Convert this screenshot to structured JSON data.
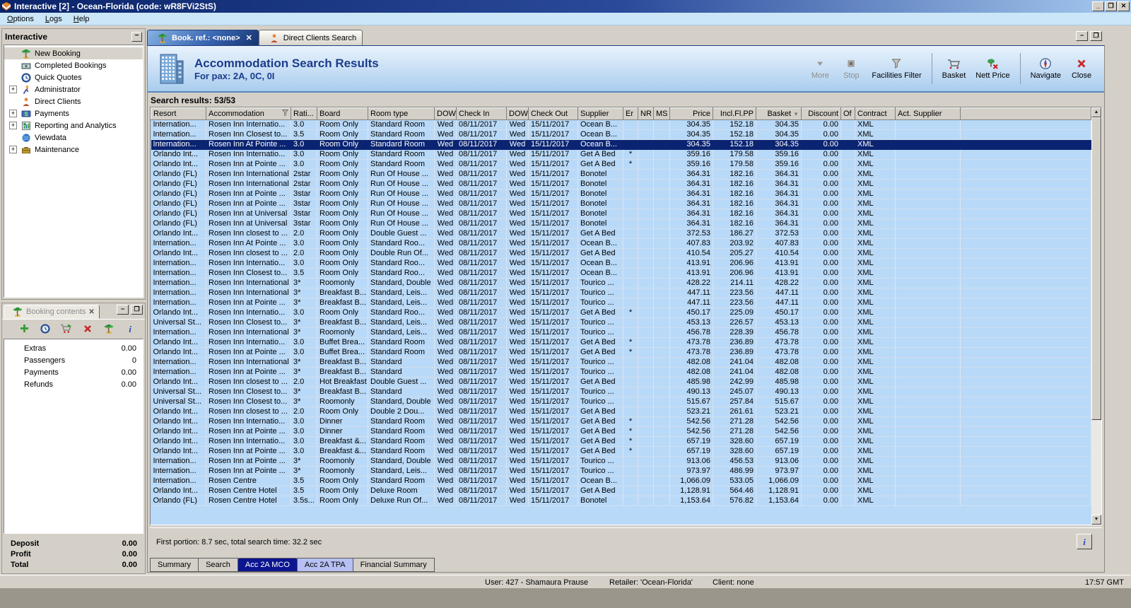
{
  "window": {
    "title": "Interactive [2] - Ocean-Florida (code: wR8FVi2StS)"
  },
  "menu": {
    "items": [
      "Options",
      "Logs",
      "Help"
    ]
  },
  "sidebar": {
    "title": "Interactive",
    "items": [
      {
        "label": "New Booking",
        "icon": "palm",
        "expandable": false,
        "selected": true
      },
      {
        "label": "Completed Bookings",
        "icon": "money",
        "expandable": false
      },
      {
        "label": "Quick Quotes",
        "icon": "clock",
        "expandable": false
      },
      {
        "label": "Administrator",
        "icon": "admin",
        "expandable": true
      },
      {
        "label": "Direct Clients",
        "icon": "person",
        "expandable": false
      },
      {
        "label": "Payments",
        "icon": "dollar",
        "expandable": true
      },
      {
        "label": "Reporting and Analytics",
        "icon": "chart",
        "expandable": true
      },
      {
        "label": "Viewdata",
        "icon": "globe",
        "expandable": false
      },
      {
        "label": "Maintenance",
        "icon": "toolbox",
        "expandable": true
      }
    ]
  },
  "booking_contents": {
    "title": "Booking contents",
    "toolbar": [
      {
        "name": "add-icon",
        "icon": "add"
      },
      {
        "name": "quick-quote-icon",
        "icon": "clock"
      },
      {
        "name": "move-to-basket-icon",
        "icon": "cartarrow"
      },
      {
        "name": "delete-icon",
        "icon": "del"
      },
      {
        "name": "new-booking-icon",
        "icon": "palm"
      },
      {
        "name": "info-icon",
        "icon": "info"
      }
    ],
    "rows": [
      [
        "Extras",
        "0.00"
      ],
      [
        "Passengers",
        "0"
      ],
      [
        "Payments",
        "0.00"
      ],
      [
        "Refunds",
        "0.00"
      ]
    ],
    "totals": [
      [
        "Deposit",
        "0.00"
      ],
      [
        "Profit",
        "0.00"
      ],
      [
        "Total",
        "0.00"
      ]
    ]
  },
  "tabs": [
    {
      "label": "Book. ref.: <none>",
      "icon": "palm",
      "active": true,
      "closable": true
    },
    {
      "label": "Direct Clients Search",
      "icon": "person",
      "active": false,
      "closable": false
    }
  ],
  "header": {
    "title": "Accommodation Search Results",
    "subtitle": "For pax: 2A, 0C, 0I"
  },
  "toolbar": [
    {
      "label": "More",
      "icon": "more",
      "disabled": true
    },
    {
      "label": "Stop",
      "icon": "stop",
      "disabled": true
    },
    {
      "label": "Facilities Filter",
      "icon": "funnel",
      "disabled": false
    },
    {
      "sep": true
    },
    {
      "label": "Basket",
      "icon": "basket",
      "disabled": false
    },
    {
      "label": "Nett Price",
      "icon": "nett",
      "disabled": false
    },
    {
      "sep": true
    },
    {
      "label": "Navigate",
      "icon": "compass",
      "disabled": false
    },
    {
      "label": "Close",
      "icon": "closex",
      "disabled": false
    }
  ],
  "results": {
    "label": "Search results: 53/53"
  },
  "table": {
    "columns": [
      "Resort",
      "Accommodation",
      "Rati...",
      "Board",
      "Room type",
      "DOW",
      "Check In",
      "DOW",
      "Check Out",
      "Supplier",
      "Er",
      "NR",
      "MS",
      "Price",
      "Incl.Fl.PP",
      "Basket",
      "Discount",
      "Of",
      "Contract",
      "Act. Supplier"
    ],
    "selected_index": 2,
    "rows": [
      [
        "Internation...",
        "Rosen Inn Internatio...",
        "3.0",
        "Room Only",
        "Standard Room",
        "Wed",
        "08/11/2017",
        "Wed",
        "15/11/2017",
        "Ocean B...",
        "",
        "",
        "",
        "304.35",
        "152.18",
        "304.35",
        "0.00",
        "",
        "XML",
        ""
      ],
      [
        "Internation...",
        "Rosen Inn Closest to...",
        "3.5",
        "Room Only",
        "Standard Room",
        "Wed",
        "08/11/2017",
        "Wed",
        "15/11/2017",
        "Ocean B...",
        "",
        "",
        "",
        "304.35",
        "152.18",
        "304.35",
        "0.00",
        "",
        "XML",
        ""
      ],
      [
        "Internation...",
        "Rosen Inn At Pointe ...",
        "3.0",
        "Room Only",
        "Standard Room",
        "Wed",
        "08/11/2017",
        "Wed",
        "15/11/2017",
        "Ocean B...",
        "",
        "",
        "",
        "304.35",
        "152.18",
        "304.35",
        "0.00",
        "",
        "XML",
        ""
      ],
      [
        "Orlando Int...",
        "Rosen Inn Internatio...",
        "3.0",
        "Room Only",
        "Standard Room",
        "Wed",
        "08/11/2017",
        "Wed",
        "15/11/2017",
        "Get A Bed",
        "*",
        "",
        "",
        "359.16",
        "179.58",
        "359.16",
        "0.00",
        "",
        "XML",
        ""
      ],
      [
        "Orlando Int...",
        "Rosen Inn at Pointe ...",
        "3.0",
        "Room Only",
        "Standard Room",
        "Wed",
        "08/11/2017",
        "Wed",
        "15/11/2017",
        "Get A Bed",
        "*",
        "",
        "",
        "359.16",
        "179.58",
        "359.16",
        "0.00",
        "",
        "XML",
        ""
      ],
      [
        "Orlando (FL)",
        "Rosen Inn International",
        "2star",
        "Room Only",
        "Run Of House ...",
        "Wed",
        "08/11/2017",
        "Wed",
        "15/11/2017",
        "Bonotel",
        "",
        "",
        "",
        "364.31",
        "182.16",
        "364.31",
        "0.00",
        "",
        "XML",
        ""
      ],
      [
        "Orlando (FL)",
        "Rosen Inn International",
        "2star",
        "Room Only",
        "Run Of House ...",
        "Wed",
        "08/11/2017",
        "Wed",
        "15/11/2017",
        "Bonotel",
        "",
        "",
        "",
        "364.31",
        "182.16",
        "364.31",
        "0.00",
        "",
        "XML",
        ""
      ],
      [
        "Orlando (FL)",
        "Rosen Inn at Pointe ...",
        "3star",
        "Room Only",
        "Run Of House ...",
        "Wed",
        "08/11/2017",
        "Wed",
        "15/11/2017",
        "Bonotel",
        "",
        "",
        "",
        "364.31",
        "182.16",
        "364.31",
        "0.00",
        "",
        "XML",
        ""
      ],
      [
        "Orlando (FL)",
        "Rosen Inn at Pointe ...",
        "3star",
        "Room Only",
        "Run Of House ...",
        "Wed",
        "08/11/2017",
        "Wed",
        "15/11/2017",
        "Bonotel",
        "",
        "",
        "",
        "364.31",
        "182.16",
        "364.31",
        "0.00",
        "",
        "XML",
        ""
      ],
      [
        "Orlando (FL)",
        "Rosen Inn at Universal",
        "3star",
        "Room Only",
        "Run Of House ...",
        "Wed",
        "08/11/2017",
        "Wed",
        "15/11/2017",
        "Bonotel",
        "",
        "",
        "",
        "364.31",
        "182.16",
        "364.31",
        "0.00",
        "",
        "XML",
        ""
      ],
      [
        "Orlando (FL)",
        "Rosen Inn at Universal",
        "3star",
        "Room Only",
        "Run Of House ...",
        "Wed",
        "08/11/2017",
        "Wed",
        "15/11/2017",
        "Bonotel",
        "",
        "",
        "",
        "364.31",
        "182.16",
        "364.31",
        "0.00",
        "",
        "XML",
        ""
      ],
      [
        "Orlando Int...",
        "Rosen Inn closest to ...",
        "2.0",
        "Room Only",
        "Double Guest ...",
        "Wed",
        "08/11/2017",
        "Wed",
        "15/11/2017",
        "Get A Bed",
        "",
        "",
        "",
        "372.53",
        "186.27",
        "372.53",
        "0.00",
        "",
        "XML",
        ""
      ],
      [
        "Internation...",
        "Rosen Inn At Pointe ...",
        "3.0",
        "Room Only",
        "Standard Roo...",
        "Wed",
        "08/11/2017",
        "Wed",
        "15/11/2017",
        "Ocean B...",
        "",
        "",
        "",
        "407.83",
        "203.92",
        "407.83",
        "0.00",
        "",
        "XML",
        ""
      ],
      [
        "Orlando Int...",
        "Rosen Inn closest to ...",
        "2.0",
        "Room Only",
        "Double Run Of...",
        "Wed",
        "08/11/2017",
        "Wed",
        "15/11/2017",
        "Get A Bed",
        "",
        "",
        "",
        "410.54",
        "205.27",
        "410.54",
        "0.00",
        "",
        "XML",
        ""
      ],
      [
        "Internation...",
        "Rosen Inn Internatio...",
        "3.0",
        "Room Only",
        "Standard Roo...",
        "Wed",
        "08/11/2017",
        "Wed",
        "15/11/2017",
        "Ocean B...",
        "",
        "",
        "",
        "413.91",
        "206.96",
        "413.91",
        "0.00",
        "",
        "XML",
        ""
      ],
      [
        "Internation...",
        "Rosen Inn Closest to...",
        "3.5",
        "Room Only",
        "Standard Roo...",
        "Wed",
        "08/11/2017",
        "Wed",
        "15/11/2017",
        "Ocean B...",
        "",
        "",
        "",
        "413.91",
        "206.96",
        "413.91",
        "0.00",
        "",
        "XML",
        ""
      ],
      [
        "Internation...",
        "Rosen Inn International",
        "3*",
        "Roomonly",
        "Standard, Double",
        "Wed",
        "08/11/2017",
        "Wed",
        "15/11/2017",
        "Tourico ...",
        "",
        "",
        "",
        "428.22",
        "214.11",
        "428.22",
        "0.00",
        "",
        "XML",
        ""
      ],
      [
        "Internation...",
        "Rosen Inn International",
        "3*",
        "Breakfast B...",
        "Standard, Leis...",
        "Wed",
        "08/11/2017",
        "Wed",
        "15/11/2017",
        "Tourico ...",
        "",
        "",
        "",
        "447.11",
        "223.56",
        "447.11",
        "0.00",
        "",
        "XML",
        ""
      ],
      [
        "Internation...",
        "Rosen Inn at Pointe ...",
        "3*",
        "Breakfast B...",
        "Standard, Leis...",
        "Wed",
        "08/11/2017",
        "Wed",
        "15/11/2017",
        "Tourico ...",
        "",
        "",
        "",
        "447.11",
        "223.56",
        "447.11",
        "0.00",
        "",
        "XML",
        ""
      ],
      [
        "Orlando Int...",
        "Rosen Inn Internatio...",
        "3.0",
        "Room Only",
        "Standard Roo...",
        "Wed",
        "08/11/2017",
        "Wed",
        "15/11/2017",
        "Get A Bed",
        "*",
        "",
        "",
        "450.17",
        "225.09",
        "450.17",
        "0.00",
        "",
        "XML",
        ""
      ],
      [
        "Universal St...",
        "Rosen Inn Closest to...",
        "3*",
        "Breakfast B...",
        "Standard, Leis...",
        "Wed",
        "08/11/2017",
        "Wed",
        "15/11/2017",
        "Tourico ...",
        "",
        "",
        "",
        "453.13",
        "226.57",
        "453.13",
        "0.00",
        "",
        "XML",
        ""
      ],
      [
        "Internation...",
        "Rosen Inn International",
        "3*",
        "Roomonly",
        "Standard, Leis...",
        "Wed",
        "08/11/2017",
        "Wed",
        "15/11/2017",
        "Tourico ...",
        "",
        "",
        "",
        "456.78",
        "228.39",
        "456.78",
        "0.00",
        "",
        "XML",
        ""
      ],
      [
        "Orlando Int...",
        "Rosen Inn Internatio...",
        "3.0",
        "Buffet Brea...",
        "Standard Room",
        "Wed",
        "08/11/2017",
        "Wed",
        "15/11/2017",
        "Get A Bed",
        "*",
        "",
        "",
        "473.78",
        "236.89",
        "473.78",
        "0.00",
        "",
        "XML",
        ""
      ],
      [
        "Orlando Int...",
        "Rosen Inn at Pointe ...",
        "3.0",
        "Buffet Brea...",
        "Standard Room",
        "Wed",
        "08/11/2017",
        "Wed",
        "15/11/2017",
        "Get A Bed",
        "*",
        "",
        "",
        "473.78",
        "236.89",
        "473.78",
        "0.00",
        "",
        "XML",
        ""
      ],
      [
        "Internation...",
        "Rosen Inn International",
        "3*",
        "Breakfast B...",
        "Standard",
        "Wed",
        "08/11/2017",
        "Wed",
        "15/11/2017",
        "Tourico ...",
        "",
        "",
        "",
        "482.08",
        "241.04",
        "482.08",
        "0.00",
        "",
        "XML",
        ""
      ],
      [
        "Internation...",
        "Rosen Inn at Pointe ...",
        "3*",
        "Breakfast B...",
        "Standard",
        "Wed",
        "08/11/2017",
        "Wed",
        "15/11/2017",
        "Tourico ...",
        "",
        "",
        "",
        "482.08",
        "241.04",
        "482.08",
        "0.00",
        "",
        "XML",
        ""
      ],
      [
        "Orlando Int...",
        "Rosen Inn closest to ...",
        "2.0",
        "Hot Breakfast",
        "Double Guest ...",
        "Wed",
        "08/11/2017",
        "Wed",
        "15/11/2017",
        "Get A Bed",
        "",
        "",
        "",
        "485.98",
        "242.99",
        "485.98",
        "0.00",
        "",
        "XML",
        ""
      ],
      [
        "Universal St...",
        "Rosen Inn Closest to...",
        "3*",
        "Breakfast B...",
        "Standard",
        "Wed",
        "08/11/2017",
        "Wed",
        "15/11/2017",
        "Tourico ...",
        "",
        "",
        "",
        "490.13",
        "245.07",
        "490.13",
        "0.00",
        "",
        "XML",
        ""
      ],
      [
        "Universal St...",
        "Rosen Inn Closest to...",
        "3*",
        "Roomonly",
        "Standard, Double",
        "Wed",
        "08/11/2017",
        "Wed",
        "15/11/2017",
        "Tourico ...",
        "",
        "",
        "",
        "515.67",
        "257.84",
        "515.67",
        "0.00",
        "",
        "XML",
        ""
      ],
      [
        "Orlando Int...",
        "Rosen Inn closest to ...",
        "2.0",
        "Room Only",
        "Double 2 Dou...",
        "Wed",
        "08/11/2017",
        "Wed",
        "15/11/2017",
        "Get A Bed",
        "",
        "",
        "",
        "523.21",
        "261.61",
        "523.21",
        "0.00",
        "",
        "XML",
        ""
      ],
      [
        "Orlando Int...",
        "Rosen Inn Internatio...",
        "3.0",
        "Dinner",
        "Standard Room",
        "Wed",
        "08/11/2017",
        "Wed",
        "15/11/2017",
        "Get A Bed",
        "*",
        "",
        "",
        "542.56",
        "271.28",
        "542.56",
        "0.00",
        "",
        "XML",
        ""
      ],
      [
        "Orlando Int...",
        "Rosen Inn at Pointe ...",
        "3.0",
        "Dinner",
        "Standard Room",
        "Wed",
        "08/11/2017",
        "Wed",
        "15/11/2017",
        "Get A Bed",
        "*",
        "",
        "",
        "542.56",
        "271.28",
        "542.56",
        "0.00",
        "",
        "XML",
        ""
      ],
      [
        "Orlando Int...",
        "Rosen Inn Internatio...",
        "3.0",
        "Breakfast &...",
        "Standard Room",
        "Wed",
        "08/11/2017",
        "Wed",
        "15/11/2017",
        "Get A Bed",
        "*",
        "",
        "",
        "657.19",
        "328.60",
        "657.19",
        "0.00",
        "",
        "XML",
        ""
      ],
      [
        "Orlando Int...",
        "Rosen Inn at Pointe ...",
        "3.0",
        "Breakfast &...",
        "Standard Room",
        "Wed",
        "08/11/2017",
        "Wed",
        "15/11/2017",
        "Get A Bed",
        "*",
        "",
        "",
        "657.19",
        "328.60",
        "657.19",
        "0.00",
        "",
        "XML",
        ""
      ],
      [
        "Internation...",
        "Rosen Inn at Pointe ...",
        "3*",
        "Roomonly",
        "Standard, Double",
        "Wed",
        "08/11/2017",
        "Wed",
        "15/11/2017",
        "Tourico ...",
        "",
        "",
        "",
        "913.06",
        "456.53",
        "913.06",
        "0.00",
        "",
        "XML",
        ""
      ],
      [
        "Internation...",
        "Rosen Inn at Pointe ...",
        "3*",
        "Roomonly",
        "Standard, Leis...",
        "Wed",
        "08/11/2017",
        "Wed",
        "15/11/2017",
        "Tourico ...",
        "",
        "",
        "",
        "973.97",
        "486.99",
        "973.97",
        "0.00",
        "",
        "XML",
        ""
      ],
      [
        "Internation...",
        "Rosen Centre",
        "3.5",
        "Room Only",
        "Standard Room",
        "Wed",
        "08/11/2017",
        "Wed",
        "15/11/2017",
        "Ocean B...",
        "",
        "",
        "",
        "1,066.09",
        "533.05",
        "1,066.09",
        "0.00",
        "",
        "XML",
        ""
      ],
      [
        "Orlando Int...",
        "Rosen Centre Hotel",
        "3.5",
        "Room Only",
        "Deluxe Room",
        "Wed",
        "08/11/2017",
        "Wed",
        "15/11/2017",
        "Get A Bed",
        "",
        "",
        "",
        "1,128.91",
        "564.46",
        "1,128.91",
        "0.00",
        "",
        "XML",
        ""
      ],
      [
        "Orlando (FL)",
        "Rosen Centre Hotel",
        "3.5s...",
        "Room Only",
        "Deluxe Run Of...",
        "Wed",
        "08/11/2017",
        "Wed",
        "15/11/2017",
        "Bonotel",
        "",
        "",
        "",
        "1,153.64",
        "576.82",
        "1,153.64",
        "0.00",
        "",
        "XML",
        ""
      ]
    ]
  },
  "footer": {
    "status": "First portion: 8.7 sec, total search time: 32.2 sec"
  },
  "bottom_tabs": [
    {
      "label": "Summary",
      "state": "normal"
    },
    {
      "label": "Search",
      "state": "normal"
    },
    {
      "label": "Acc 2A MCO",
      "state": "active"
    },
    {
      "label": "Acc 2A TPA",
      "state": "alt"
    },
    {
      "label": "Financial Summary",
      "state": "normal"
    }
  ],
  "statusbar": {
    "user": "User: 427 - Shamaura Prause",
    "retailer": "Retailer: 'Ocean-Florida'",
    "client": "Client: none",
    "time": "17:57 GMT"
  },
  "colors": {
    "accent": "#0a2472",
    "row": "#b9d9f8",
    "header_band": "#c6def5",
    "title_text": "#1b3c8a"
  }
}
